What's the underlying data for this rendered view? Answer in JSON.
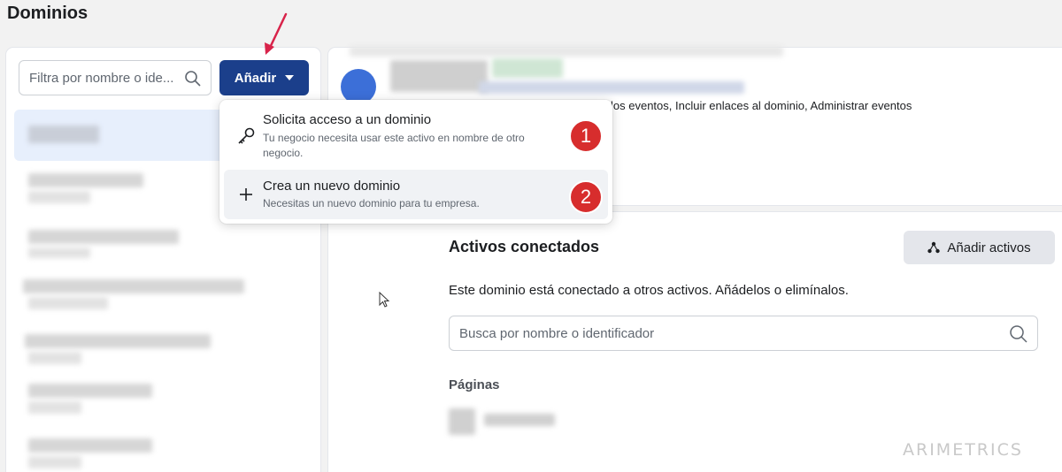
{
  "page": {
    "title": "Dominios"
  },
  "left_panel": {
    "filter_placeholder": "Filtra por nombre o ide...",
    "add_button_label": "Añadir"
  },
  "dropdown": {
    "items": [
      {
        "title": "Solicita acceso a un dominio",
        "subtitle": "Tu negocio necesita usar este activo en nombre de otro negocio.",
        "icon": "key-icon",
        "badge": "1"
      },
      {
        "title": "Crea un nuevo dominio",
        "subtitle": "Necesitas un nuevo dominio para tu empresa.",
        "icon": "plus-icon",
        "badge": "2"
      }
    ]
  },
  "detail": {
    "permissions_text": "los eventos, Incluir enlaces al dominio, Administrar eventos"
  },
  "connected_assets": {
    "title": "Activos conectados",
    "add_button_label": "Añadir activos",
    "description": "Este dominio está conectado a otros activos. Añádelos o elimínalos.",
    "search_placeholder": "Busca por nombre o identificador",
    "pages_label": "Páginas"
  },
  "watermark": "ARIMETRICS",
  "colors": {
    "primary": "#1b3f8b",
    "badge": "#d72d2d",
    "selected": "#e7effc"
  }
}
